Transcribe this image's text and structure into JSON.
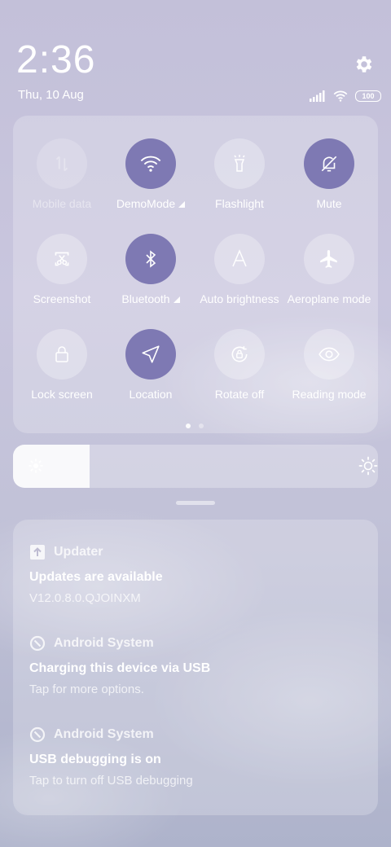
{
  "header": {
    "time": "2:36",
    "date": "Thu, 10 Aug",
    "battery": "100"
  },
  "tiles": [
    {
      "label": "Mobile data",
      "state": "disabled",
      "icon": "mobile-data-icon"
    },
    {
      "label": "DemoMode",
      "state": "on",
      "icon": "wifi-icon"
    },
    {
      "label": "Flashlight",
      "state": "off",
      "icon": "flashlight-icon"
    },
    {
      "label": "Mute",
      "state": "on",
      "icon": "bell-off-icon"
    },
    {
      "label": "Screenshot",
      "state": "off",
      "icon": "screenshot-icon"
    },
    {
      "label": "Bluetooth",
      "state": "on",
      "icon": "bluetooth-icon"
    },
    {
      "label": "Auto brightness",
      "state": "off",
      "icon": "auto-brightness-icon"
    },
    {
      "label": "Aeroplane mode",
      "state": "off",
      "icon": "airplane-icon"
    },
    {
      "label": "Lock screen",
      "state": "off",
      "icon": "lock-icon"
    },
    {
      "label": "Location",
      "state": "on",
      "icon": "location-icon"
    },
    {
      "label": "Rotate off",
      "state": "off",
      "icon": "rotate-lock-icon"
    },
    {
      "label": "Reading mode",
      "state": "off",
      "icon": "eye-icon"
    }
  ],
  "brightness": {
    "level": 0.21
  },
  "pages": {
    "count": 2,
    "current": 1
  },
  "notifications": [
    {
      "app": "Updater",
      "title": "Updates are available",
      "text": "V12.0.8.0.QJOINXM",
      "icon": "upload-icon"
    },
    {
      "app": "Android System",
      "title": "Charging this device via USB",
      "text": "Tap for more options.",
      "icon": "android-system-icon"
    },
    {
      "app": "Android System",
      "title": "USB debugging is on",
      "text": "Tap to turn off USB debugging",
      "icon": "android-system-icon"
    }
  ],
  "colors": {
    "accent": "#7e79b3"
  }
}
